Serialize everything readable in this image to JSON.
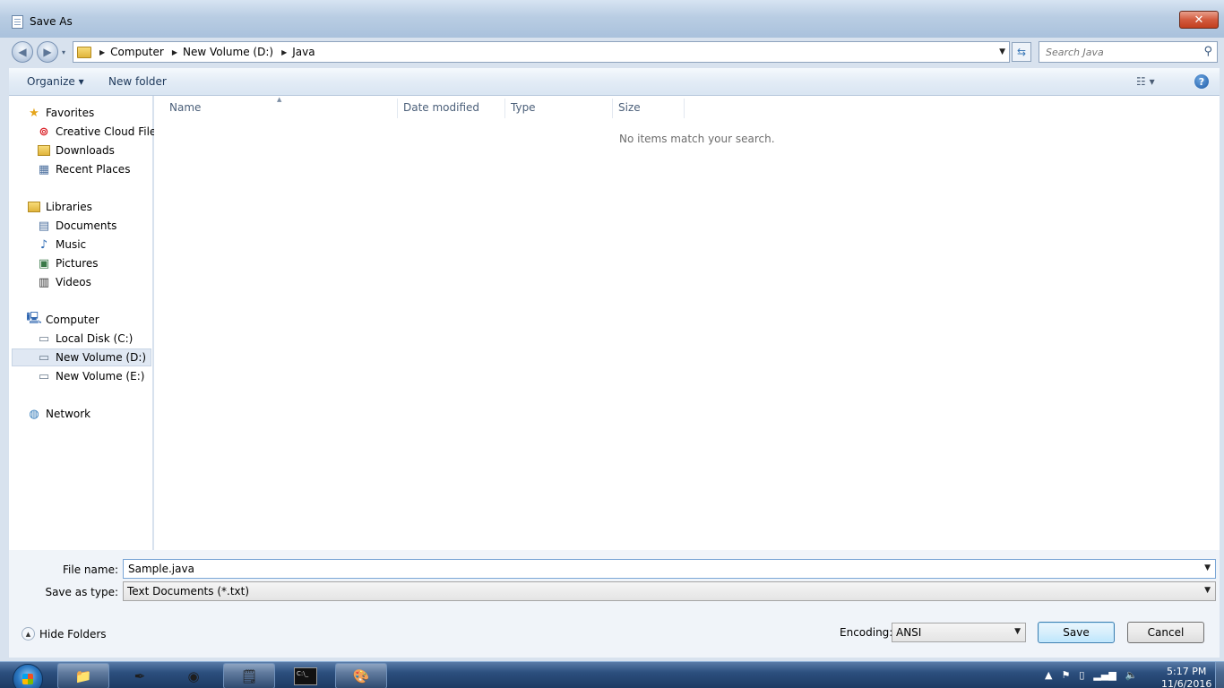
{
  "window": {
    "title": "Save As",
    "close_label": "✕"
  },
  "address": {
    "crumbs": [
      "Computer",
      "New Volume (D:)",
      "Java"
    ],
    "search_placeholder": "Search Java"
  },
  "toolbar": {
    "organize_label": "Organize ▾",
    "new_folder_label": "New folder",
    "views_label": "☷ ▾",
    "help_label": "?"
  },
  "nav": {
    "favorites": {
      "label": "Favorites",
      "items": [
        "Creative Cloud Files",
        "Downloads",
        "Recent Places"
      ]
    },
    "libraries": {
      "label": "Libraries",
      "items": [
        "Documents",
        "Music",
        "Pictures",
        "Videos"
      ]
    },
    "computer": {
      "label": "Computer",
      "items": [
        "Local Disk (C:)",
        "New Volume (D:)",
        "New Volume (E:)"
      ],
      "selected": "New Volume (D:)"
    },
    "network": {
      "label": "Network"
    }
  },
  "content": {
    "columns": [
      "Name",
      "Date modified",
      "Type",
      "Size"
    ],
    "empty_message": "No items match your search."
  },
  "form": {
    "file_name_label": "File name:",
    "file_name_value": "Sample.java",
    "save_type_label": "Save as type:",
    "save_type_value": "Text Documents (*.txt)",
    "hide_folders_label": "Hide Folders",
    "encoding_label": "Encoding:",
    "encoding_value": "ANSI",
    "save_label": "Save",
    "cancel_label": "Cancel"
  },
  "taskbar": {
    "time": "5:17 PM",
    "date": "11/6/2016"
  }
}
